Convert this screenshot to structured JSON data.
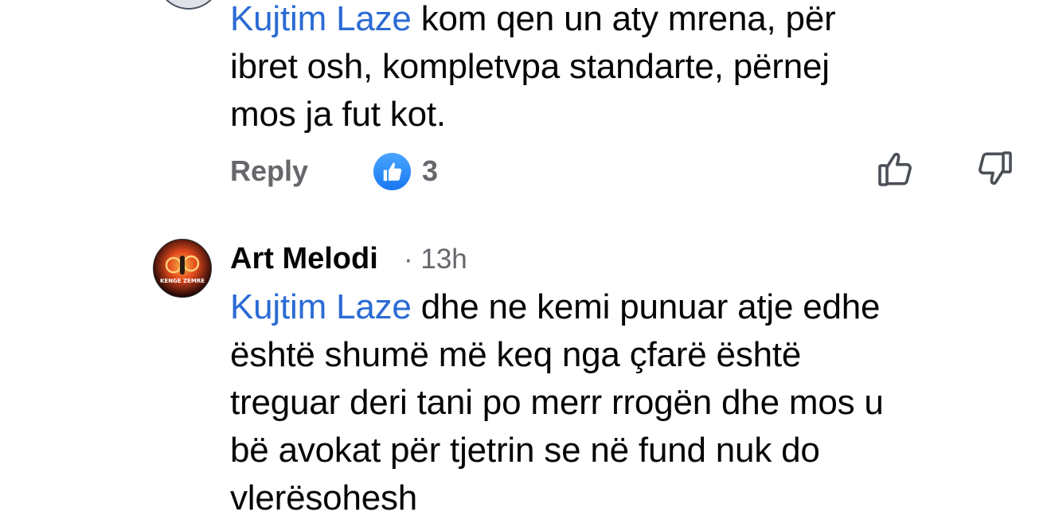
{
  "comment_top": {
    "mention": "Kujtim Laze",
    "lines": [
      " kom qen un aty mrena, për",
      "ibret osh, kompletvpa standarte, përnej",
      "mos ja fut kot."
    ],
    "actions": {
      "reply_label": "Reply",
      "reaction_icon": "thumbs-up-icon",
      "reaction_count": "3",
      "upvote_icon": "thumbs-up-outline-icon",
      "downvote_icon": "thumbs-down-outline-icon"
    }
  },
  "comment_second": {
    "author": "Art Melodi",
    "time": "· 13h",
    "avatar_text": "KENGE ZEMRE",
    "mention": "Kujtim Laze",
    "lines": [
      " dhe ne kemi punuar atje edhe",
      "është shumë më keq nga çfarë është",
      "treguar deri tani po merr rrogën dhe mos u",
      "bë avokat për tjetrin se në fund nuk do",
      "vlerësohesh"
    ]
  },
  "colors": {
    "mention": "#2b6bd4",
    "muted": "#65676b",
    "like_blue": "#1877f2"
  }
}
